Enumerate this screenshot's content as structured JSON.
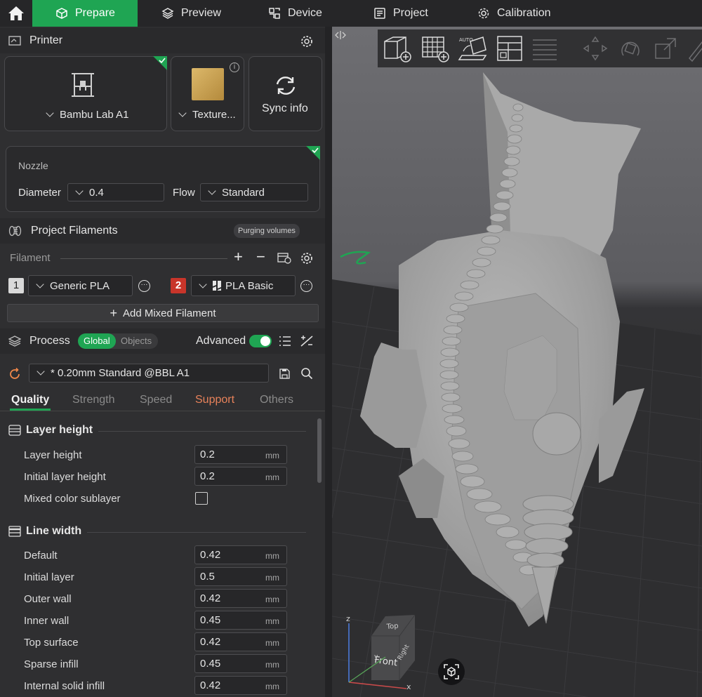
{
  "topbar": {
    "tabs": [
      {
        "label": "Prepare",
        "icon": "cube-icon"
      },
      {
        "label": "Preview",
        "icon": "layers-icon"
      },
      {
        "label": "Device",
        "icon": "device-icon"
      },
      {
        "label": "Project",
        "icon": "project-icon"
      },
      {
        "label": "Calibration",
        "icon": "calibration-icon"
      }
    ],
    "active_color": "#1fa553"
  },
  "printer": {
    "title": "Printer",
    "name": "Bambu Lab A1",
    "plate": "Texture...",
    "sync_label": "Sync info"
  },
  "nozzle": {
    "title": "Nozzle",
    "diameter_label": "Diameter",
    "diameter_value": "0.4",
    "flow_label": "Flow",
    "flow_value": "Standard"
  },
  "filaments": {
    "title": "Project Filaments",
    "purging_label": "Purging volumes",
    "filament_label": "Filament",
    "items": [
      {
        "index": "1",
        "name": "Generic PLA",
        "color": "#d9d9d9"
      },
      {
        "index": "2",
        "name": "PLA Basic",
        "color": "#c8352a"
      }
    ],
    "add_mixed_label": "Add Mixed Filament"
  },
  "process": {
    "title": "Process",
    "global_label": "Global",
    "objects_label": "Objects",
    "advanced_label": "Advanced",
    "advanced_on": true,
    "preset": "* 0.20mm Standard @BBL A1",
    "tabs": [
      "Quality",
      "Strength",
      "Speed",
      "Support",
      "Others"
    ],
    "active_tab": "Quality"
  },
  "quality": {
    "layer_group": "Layer height",
    "layer_height_label": "Layer height",
    "layer_height": "0.2",
    "initial_layer_height_label": "Initial layer height",
    "initial_layer_height": "0.2",
    "mixed_sublayer_label": "Mixed color sublayer",
    "mixed_sublayer_checked": false,
    "line_group": "Line width",
    "unit": "mm",
    "line_widths": [
      {
        "label": "Default",
        "value": "0.42"
      },
      {
        "label": "Initial layer",
        "value": "0.5"
      },
      {
        "label": "Outer wall",
        "value": "0.42"
      },
      {
        "label": "Inner wall",
        "value": "0.45"
      },
      {
        "label": "Top surface",
        "value": "0.42"
      },
      {
        "label": "Sparse infill",
        "value": "0.45"
      },
      {
        "label": "Internal solid infill",
        "value": "0.42"
      }
    ]
  },
  "viewport": {
    "cube_faces": {
      "top": "Top",
      "front": "Front",
      "right": "Right"
    },
    "axes": {
      "z": "z",
      "x": "x",
      "y": "y"
    }
  }
}
